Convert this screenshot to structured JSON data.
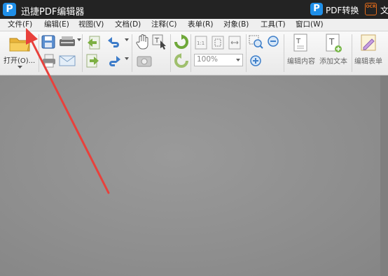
{
  "app": {
    "logo_letter": "P",
    "title": "迅捷PDF编辑器"
  },
  "titlebar_right": {
    "convert_logo_letter": "P",
    "convert_label": "PDF转换",
    "ocr_label": "OCR",
    "extra_label": "文"
  },
  "menu": {
    "items": [
      {
        "label": "文件(F)"
      },
      {
        "label": "编辑(E)"
      },
      {
        "label": "视图(V)"
      },
      {
        "label": "文档(D)"
      },
      {
        "label": "注释(C)"
      },
      {
        "label": "表单(R)"
      },
      {
        "label": "对象(B)"
      },
      {
        "label": "工具(T)"
      },
      {
        "label": "窗口(W)"
      }
    ]
  },
  "toolbar": {
    "open_label": "打开(O)...",
    "zoom_value": "100%",
    "edit_content_label": "编辑内容",
    "add_text_label": "添加文本",
    "edit_form_label": "编辑表单"
  },
  "colors": {
    "annotation_arrow": "#e8413c",
    "brand_blue": "#1f8fe8",
    "ocr_orange": "#e06a1a"
  }
}
